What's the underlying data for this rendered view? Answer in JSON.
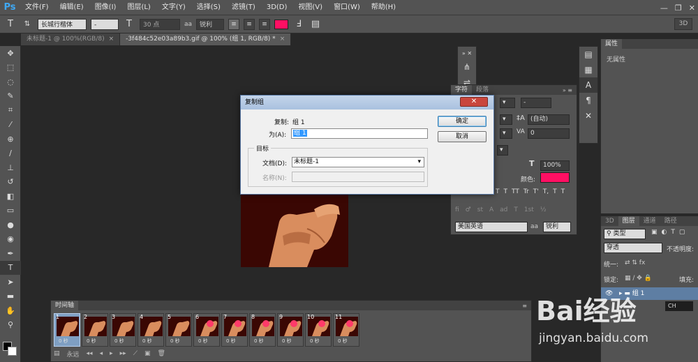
{
  "app": {
    "logo": "Ps"
  },
  "menu": [
    "文件(F)",
    "编辑(E)",
    "图像(I)",
    "图层(L)",
    "文字(Y)",
    "选择(S)",
    "滤镜(T)",
    "3D(D)",
    "视图(V)",
    "窗口(W)",
    "帮助(H)"
  ],
  "options": {
    "font_family": "长城行楷体",
    "font_style": "-",
    "font_size": "30 点",
    "aa_label": "aa",
    "aa_mode": "锐利",
    "color": "#ff0f63",
    "mode_3d": "3D"
  },
  "tabs": [
    {
      "label": "未标题-1 @ 100%(RGB/8)"
    },
    {
      "label": "-3f484c52e03a89b3.gif @ 100% (组 1, RGB/8) *"
    }
  ],
  "char_panel": {
    "tabs": [
      "字符",
      "段落"
    ],
    "leading": "(自动)",
    "tracking": "0",
    "scale": "100%",
    "color_label": "颜色:",
    "language": "美国英语",
    "aa_label": "aa",
    "aa_mode": "锐利",
    "glyphs": [
      "T",
      "T",
      "TT",
      "Tr",
      "T'",
      "T,",
      "T",
      "T"
    ]
  },
  "properties": {
    "title": "属性",
    "empty": "无属性"
  },
  "layers": {
    "tabs": [
      "3D",
      "图层",
      "通道",
      "路径"
    ],
    "kind": "类型",
    "blend": "穿透",
    "opacity_label": "不透明度:",
    "unify_label": "统一:",
    "lock_label": "锁定:",
    "fill_label": "填充:",
    "layer_name": "组 1",
    "ime": "CH"
  },
  "timeline": {
    "title": "时间轴",
    "frames": [
      {
        "n": "1",
        "delay": "0 秒"
      },
      {
        "n": "2",
        "delay": "0 秒"
      },
      {
        "n": "3",
        "delay": "0 秒"
      },
      {
        "n": "4",
        "delay": "0 秒"
      },
      {
        "n": "5",
        "delay": "0 秒"
      },
      {
        "n": "6",
        "delay": "0 秒"
      },
      {
        "n": "7",
        "delay": "0 秒"
      },
      {
        "n": "8",
        "delay": "0 秒"
      },
      {
        "n": "9",
        "delay": "0 秒"
      },
      {
        "n": "10",
        "delay": "0 秒"
      },
      {
        "n": "11",
        "delay": "0 秒"
      }
    ],
    "loop": "永远"
  },
  "dialog": {
    "title": "复制组",
    "copy_label": "复制:",
    "copy_value": "组 1",
    "as_label": "为(A):",
    "as_value": "组 1",
    "group_label": "目标",
    "doc_label": "文档(D):",
    "doc_value": "未标题-1",
    "name_label": "名称(N):",
    "ok": "确定",
    "cancel": "取消"
  },
  "watermark": {
    "brand": "Bai经验",
    "url": "jingyan.baidu.com"
  }
}
